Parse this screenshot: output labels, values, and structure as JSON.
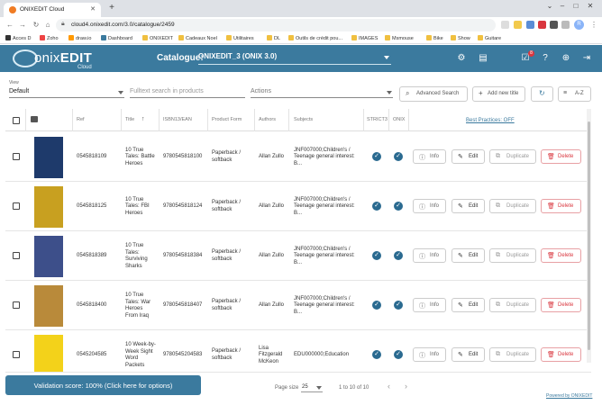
{
  "browser": {
    "tab_title": "ONIXEDIT Cloud",
    "url": "cloud4.onixedit.com/3.0/catalogue/2459",
    "bookmarks": [
      "Acces D",
      "Zoho",
      "draw.io",
      "Dashboard",
      "ONIXEDIT",
      "Cadeaux Noel",
      "Utilitaires",
      "DL",
      "Outils de crédit pou...",
      "IMAGES",
      "Msmouse",
      "Bike",
      "Show",
      "Guitare"
    ],
    "profile_initial": "R"
  },
  "header": {
    "logo_text_light": "onix",
    "logo_text_bold": "EDIT",
    "logo_sub": "Cloud",
    "catalogue_label": "Catalogue:",
    "catalogue_value": "ONIXEDIT_3 (ONIX 3.0)",
    "notification_count": "8"
  },
  "toolbar": {
    "view_label": "View",
    "view_value": "Default",
    "search_placeholder": "Fulltext search in products",
    "actions_label": "Actions",
    "advanced_search": "Advanced Search",
    "add_new_title": "Add new title",
    "sort_label": "A-Z"
  },
  "table": {
    "columns": {
      "ref": "Ref",
      "title": "Title",
      "isbn": "ISBN13/EAN",
      "form": "Product Form",
      "authors": "Authors",
      "subjects": "Subjects",
      "strict": "STRICT3",
      "onix": "ONIX",
      "best_practices": "Best Practices: OFF"
    },
    "buttons": {
      "info": "Info",
      "edit": "Edit",
      "duplicate": "Duplicate",
      "delete": "Delete"
    },
    "rows": [
      {
        "ref": "0545818109",
        "title": [
          "10 True",
          "Tales: Battle",
          "Heroes"
        ],
        "isbn": "9780545818100",
        "form": [
          "Paperback /",
          "softback"
        ],
        "authors": [
          "Allan Zullo"
        ],
        "subjects": [
          "JNF007000;Children's /",
          "Teenage general interest:",
          "B..."
        ],
        "cover": "#1e3a6b"
      },
      {
        "ref": "0545818125",
        "title": [
          "10 True",
          "Tales: FBI",
          "Heroes"
        ],
        "isbn": "9780545818124",
        "form": [
          "Paperback /",
          "softback"
        ],
        "authors": [
          "Allan Zullo"
        ],
        "subjects": [
          "JNF007000;Children's /",
          "Teenage general interest:",
          "B..."
        ],
        "cover": "#c8a020"
      },
      {
        "ref": "0545818389",
        "title": [
          "10 True",
          "Tales:",
          "Surviving",
          "Sharks"
        ],
        "isbn": "9780545818384",
        "form": [
          "Paperback /",
          "softback"
        ],
        "authors": [
          "Allan Zullo"
        ],
        "subjects": [
          "JNF007000;Children's /",
          "Teenage general interest:",
          "B..."
        ],
        "cover": "#3d4f8a"
      },
      {
        "ref": "0545818400",
        "title": [
          "10 True",
          "Tales: War",
          "Heroes",
          "From Iraq"
        ],
        "isbn": "9780545818407",
        "form": [
          "Paperback /",
          "softback"
        ],
        "authors": [
          "Allan Zullo"
        ],
        "subjects": [
          "JNF007000;Children's /",
          "Teenage general interest:",
          "B..."
        ],
        "cover": "#b98a3a"
      },
      {
        "ref": "0545204585",
        "title": [
          "10 Week-by-",
          "Week Sight",
          "Word",
          "Packets"
        ],
        "isbn": "9780545204583",
        "form": [
          "Paperback /",
          "softback"
        ],
        "authors": [
          "Lisa",
          "Fitzgerald",
          "McKeon"
        ],
        "subjects": [
          "EDU000000;Education"
        ],
        "cover": "#f3d21a"
      }
    ]
  },
  "footer": {
    "validation": "Validation score: 100% (Click here for options)",
    "page_size_label": "Page size",
    "page_size": "25",
    "range": "1 to 10 of 10",
    "powered": "Powered by ONIXEDIT"
  },
  "colors": {
    "header": "#3b7a9e",
    "check": "#2a6a90",
    "delete": "#d9363e"
  }
}
